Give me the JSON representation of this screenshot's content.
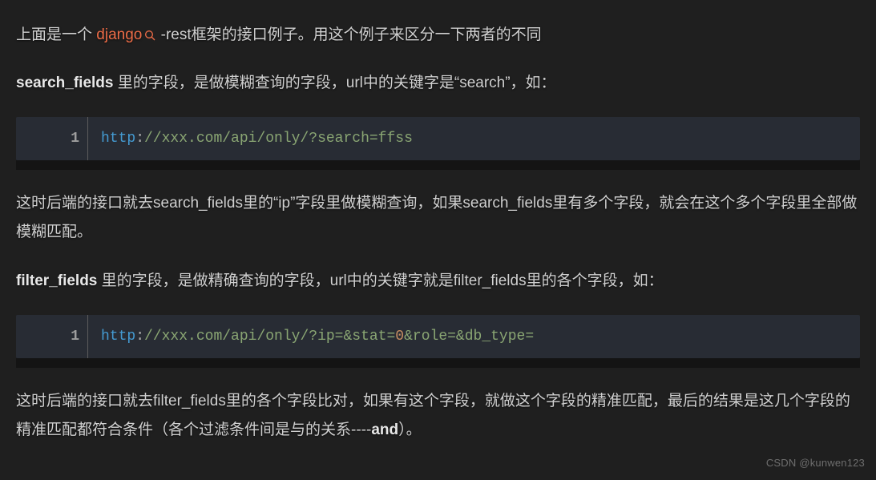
{
  "p1": {
    "pre": "上面是一个 ",
    "tag": "django",
    "post": " -rest框架的接口例子。用这个例子来区分一下两者的不同"
  },
  "p2": {
    "bold": "search_fields",
    "rest": " 里的字段，是做模糊查询的字段，url中的关键字是“search”，如："
  },
  "code1": {
    "line_no": "1",
    "t_http": "http",
    "t_colon": ":",
    "t_path": "//xxx.com/api/only/?search=ffss"
  },
  "p3": "这时后端的接口就去search_fields里的“ip”字段里做模糊查询，如果search_fields里有多个字段，就会在这个多个字段里全部做模糊匹配。",
  "p4": {
    "bold": "filter_fields",
    "rest": " 里的字段，是做精确查询的字段，url中的关键字就是filter_fields里的各个字段，如："
  },
  "code2": {
    "line_no": "1",
    "t_http": "http",
    "t_colon": ":",
    "t_path1": "//xxx.com/api/only/?ip=&stat=",
    "t_num": "0",
    "t_path2": "&role=&db_type="
  },
  "p5": {
    "pre": "这时后端的接口就去filter_fields里的各个字段比对，如果有这个字段，就做这个字段的精准匹配，最后的结果是这几个字段的精准匹配都符合条件（各个过滤条件间是与的关系----",
    "bold": "and",
    "post": "）。"
  },
  "watermark": "CSDN @kunwen123"
}
